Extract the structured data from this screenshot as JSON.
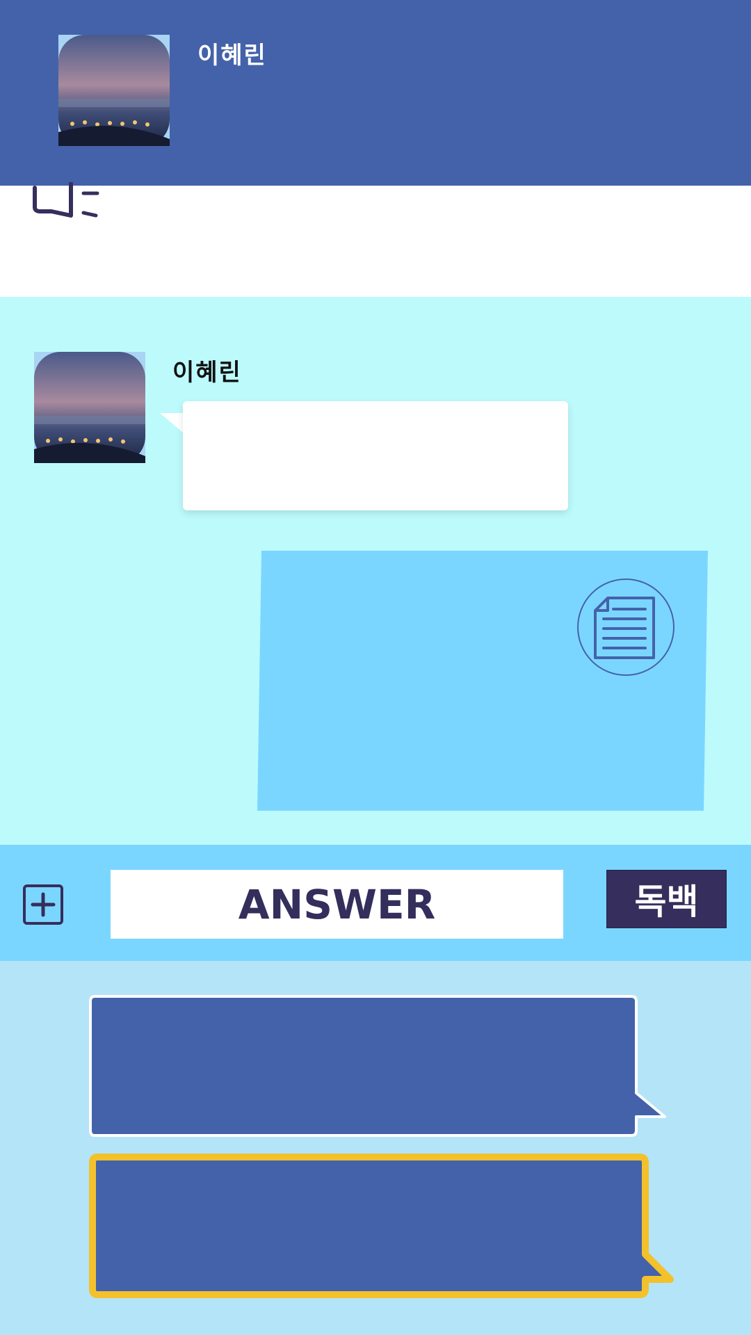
{
  "header": {
    "avatar_icon": "profile-photo-night-city",
    "name": "이혜린",
    "background_color": "#4462aa"
  },
  "notice": {
    "icon": "megaphone-icon"
  },
  "chat": {
    "background_color": "#bdfafc",
    "message": {
      "sender_name": "이혜린",
      "avatar_icon": "profile-photo-night-city",
      "text": ""
    },
    "attachment": {
      "icon": "document-icon",
      "card_color": "#7bd6ff"
    }
  },
  "input_bar": {
    "add_icon": "plus-square-icon",
    "answer_text": "ANSWER",
    "monologue_label": "독백"
  },
  "choices": [
    {
      "text": "",
      "selected": false,
      "fill": "#4462aa",
      "border": "#ffffff"
    },
    {
      "text": "",
      "selected": true,
      "fill": "#4462aa",
      "border": "#f3c12b"
    }
  ]
}
